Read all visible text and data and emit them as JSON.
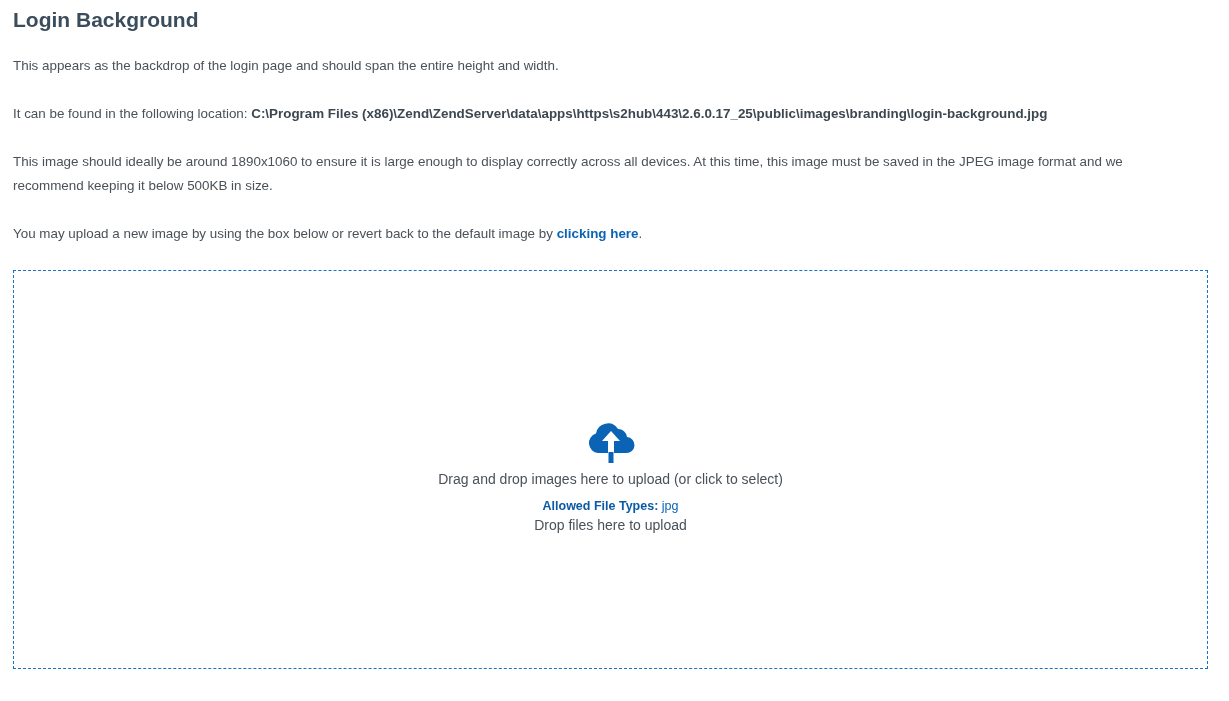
{
  "title": "Login Background",
  "paragraphs": [
    {
      "kind": "text",
      "text": "This appears as the backdrop of the login page and should span the entire height and width."
    },
    {
      "kind": "text",
      "text": "It can be found in the following location: **C:\\Program Files (x86)\\Zend\\ZendServer\\data\\apps\\https\\s2hub\\443\\2.6.0.17_25\\public\\images\\branding\\login-background.jpg**"
    },
    {
      "kind": "text",
      "text": "This image should ideally be around 1890x1060 to ensure it is large enough to display correctly across all devices. At this time, this image must be saved in the JPEG image format and we recommend keeping it below 500KB in size."
    },
    {
      "kind": "link",
      "before": "You may upload a new image by using the box below or revert back to the default image by ",
      "link": "clicking here",
      "after": "."
    }
  ],
  "dropzone": {
    "message": "Drag and drop images here to upload (or click to select)",
    "allowed_label": "Allowed File Types:",
    "allowed_value": "jpg",
    "hint": "Drop files here to upload"
  }
}
